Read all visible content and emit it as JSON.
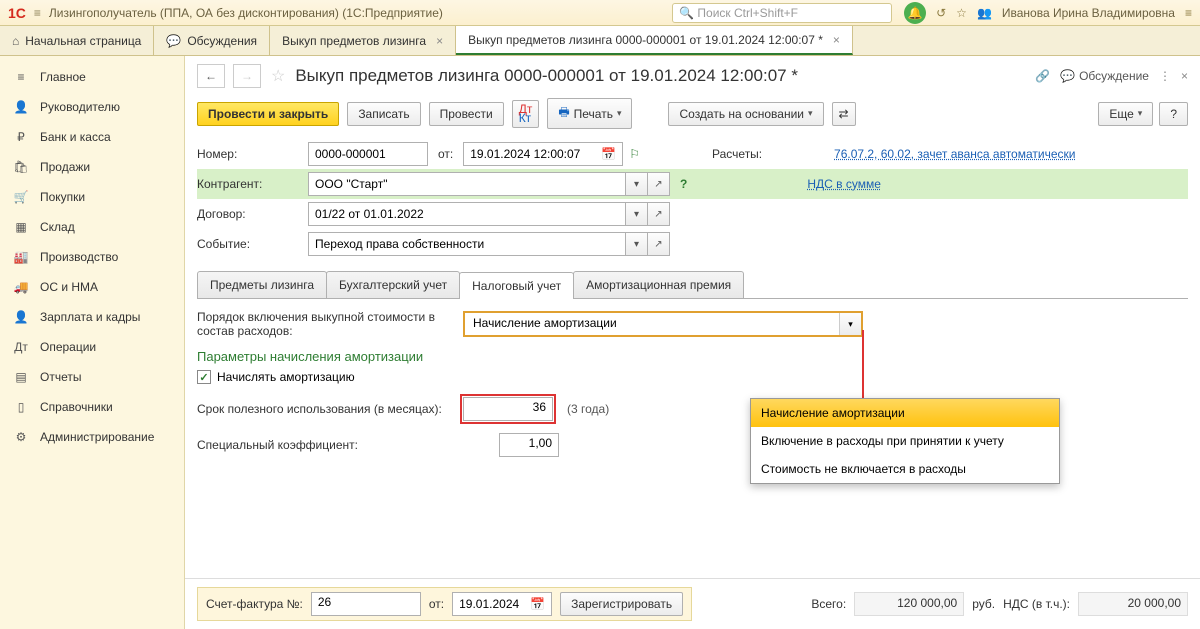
{
  "titlebar": {
    "app_title": "Лизингополучатель (ППА, ОА без дисконтирования)  (1С:Предприятие)",
    "search_placeholder": "Поиск Ctrl+Shift+F",
    "username": "Иванова Ирина Владимировна"
  },
  "toptabs": {
    "home": "Начальная страница",
    "discussions": "Обсуждения",
    "tab1": "Выкуп предметов лизинга",
    "tab2": "Выкуп предметов лизинга 0000-000001 от 19.01.2024 12:00:07 *"
  },
  "sidebar": {
    "items": [
      "Главное",
      "Руководителю",
      "Банк и касса",
      "Продажи",
      "Покупки",
      "Склад",
      "Производство",
      "ОС и НМА",
      "Зарплата и кадры",
      "Операции",
      "Отчеты",
      "Справочники",
      "Администрирование"
    ]
  },
  "doc": {
    "title": "Выкуп предметов лизинга 0000-000001 от 19.01.2024 12:00:07 *",
    "discuss": "Обсуждение",
    "toolbar": {
      "post_close": "Провести и закрыть",
      "save": "Записать",
      "post": "Провести",
      "print": "Печать",
      "create_based": "Создать на основании",
      "more": "Еще",
      "help": "?"
    },
    "fields": {
      "number_label": "Номер:",
      "number": "0000-000001",
      "ot": "от:",
      "date": "19.01.2024 12:00:07",
      "calc_label": "Расчеты:",
      "calc_link": "76.07.2, 60.02, зачет аванса автоматически",
      "contragent_label": "Контрагент:",
      "contragent": "ООО \"Старт\"",
      "vat_link": "НДС в сумме",
      "contract_label": "Договор:",
      "contract": "01/22 от 01.01.2022",
      "event_label": "Событие:",
      "event": "Переход права собственности"
    },
    "tabs": {
      "t1": "Предметы лизинга",
      "t2": "Бухгалтерский учет",
      "t3": "Налоговый учет",
      "t4": "Амортизационная премия"
    },
    "tax": {
      "order_label": "Порядок включения выкупной стоимости в состав расходов:",
      "order_value": "Начисление амортизации",
      "section": "Параметры начисления амортизации",
      "calc_amort": "Начислять амортизацию",
      "useful_life_label": "Срок полезного использования (в месяцах):",
      "useful_life": "36",
      "useful_hint": "(3 года)",
      "coeff_label": "Специальный коэффициент:",
      "coeff": "1,00",
      "options": {
        "o1": "Начисление амортизации",
        "o2": "Включение в расходы при принятии к учету",
        "o3": "Стоимость не включается в расходы"
      }
    },
    "footer": {
      "sf_label": "Счет-фактура №:",
      "sf_num": "26",
      "sf_ot": "от:",
      "sf_date": "19.01.2024",
      "register": "Зарегистрировать",
      "total_label": "Всего:",
      "total": "120 000,00",
      "rub": "руб.",
      "vat_label": "НДС (в т.ч.):",
      "vat": "20 000,00"
    }
  }
}
